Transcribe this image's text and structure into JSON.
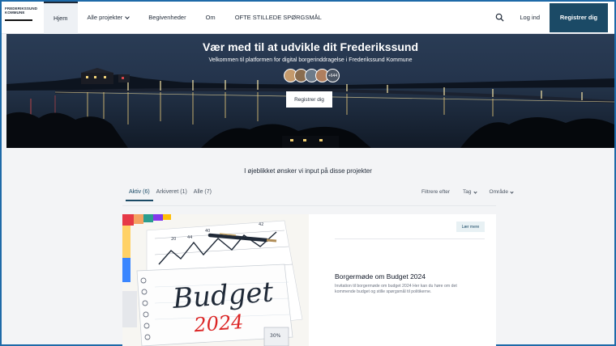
{
  "logo": {
    "line1": "FREDERIKSSUND",
    "line2": "KOMMUNE"
  },
  "nav": {
    "items": [
      {
        "label": "Hjem"
      },
      {
        "label": "Alle projekter"
      },
      {
        "label": "Begivenheder"
      },
      {
        "label": "Om"
      },
      {
        "label": "OFTE STILLEDE SPØRGSMÅL"
      }
    ],
    "login": "Log ind",
    "register": "Registrer dig"
  },
  "hero": {
    "title": "Vær med til at udvikle dit Frederikssund",
    "subtitle": "Velkommen til platformen for digital borgerinddragelse i Frederikssund Kommune",
    "avatar_count": "+644",
    "button": "Registrer dig"
  },
  "projects": {
    "heading": "I øjeblikket ønsker vi input på disse projekter",
    "tabs": [
      {
        "label": "Aktiv (6)"
      },
      {
        "label": "Arkiveret (1)"
      },
      {
        "label": "Alle (7)"
      }
    ],
    "filters": {
      "filter": "Filtrere efter",
      "tag": "Tag",
      "area": "Område"
    },
    "card": {
      "image_text": {
        "word": "Budget",
        "year": "2024",
        "note": "30%"
      },
      "learn_more": "Lær mere",
      "title": "Borgermøde om Budget 2024",
      "description": "Invitation til borgermøde om budget 2024 Her kan du høre om det kommende budget og stille spørgsmål til politikerne."
    }
  },
  "colors": {
    "primary": "#1b4a66",
    "frame": "#1e6aa8"
  }
}
